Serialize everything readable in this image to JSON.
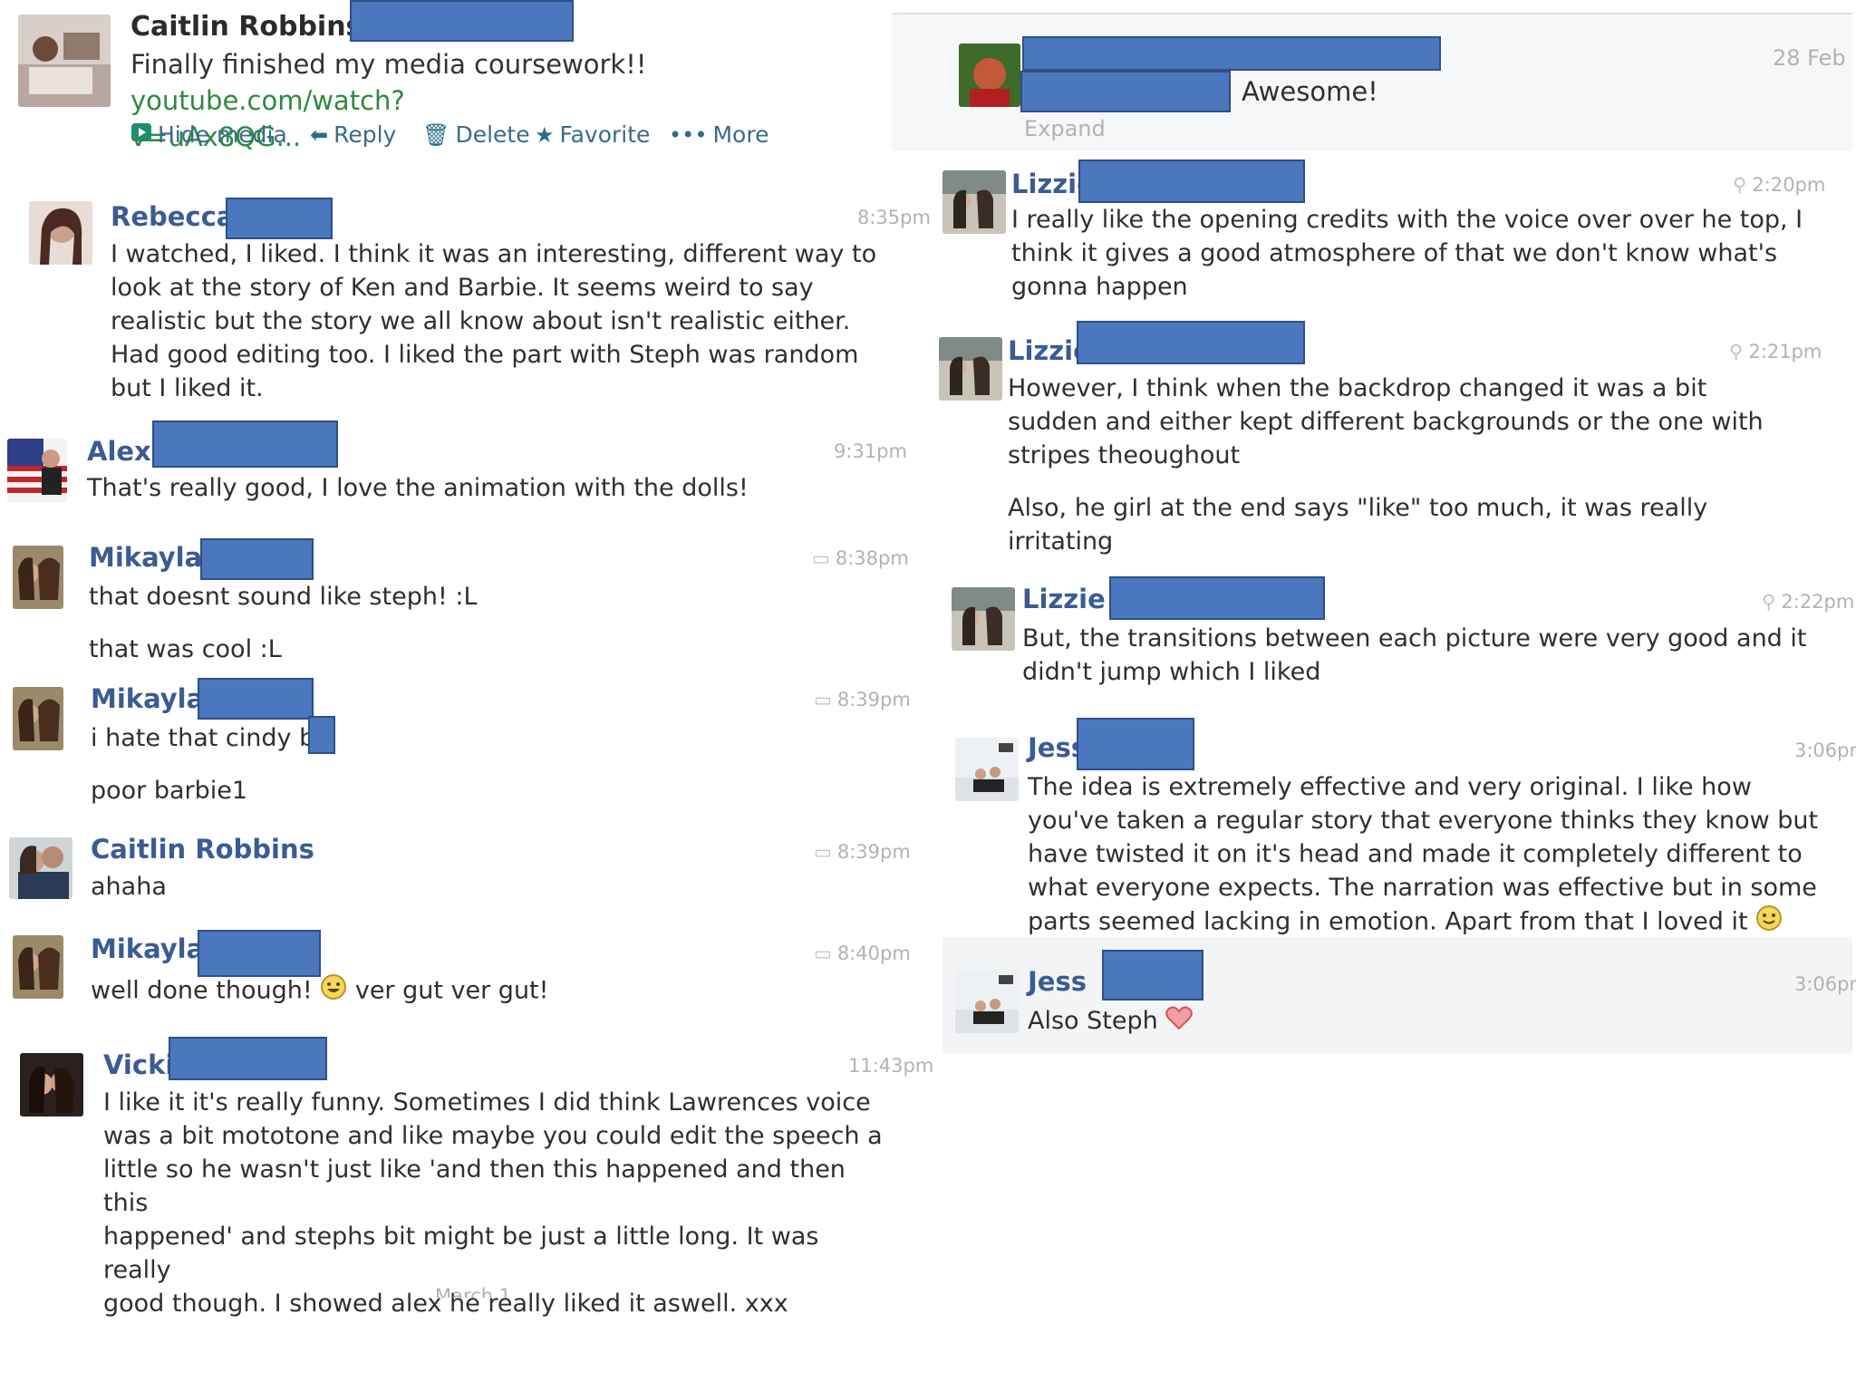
{
  "tweet": {
    "author": "Caitlin Robbins",
    "text": "Finally finished my media coursework!! ",
    "link_line1": "youtube.com/watch?",
    "link_line2": "v=uAx8QG...",
    "actions": [
      {
        "label": "Hide media",
        "icon": "media-icon"
      },
      {
        "label": "Reply",
        "icon": "reply-icon"
      },
      {
        "label": "Delete",
        "icon": "trash-icon"
      },
      {
        "label": "Favorite",
        "icon": "star-icon"
      },
      {
        "label": "More",
        "icon": "more-icon"
      }
    ]
  },
  "left_comments": [
    {
      "name": "Rebecca",
      "time": "8:35pm",
      "text": [
        "I watched, I liked. I think it was an interesting, different way to",
        "look at the story of Ken and Barbie. It seems weird to say",
        "realistic but the story we all know about isn't realistic either.",
        "Had good editing too. I liked the part with Steph was random",
        "but I liked it."
      ]
    },
    {
      "name": "Alex",
      "time": "9:31pm",
      "text": [
        "That's really good, I love the animation with the dolls!"
      ]
    },
    {
      "name": "Mikayla I",
      "time": "8:38pm",
      "text": [
        "that doesnt sound like steph! :L"
      ],
      "extra": "that was cool :L"
    },
    {
      "name": "Mikayla I",
      "time": "8:39pm",
      "text": [
        "i hate that cindy bit"
      ],
      "extra": "poor barbie1"
    },
    {
      "name": "Caitlin Robbins",
      "time": "8:39pm",
      "text": [
        "ahaha"
      ]
    },
    {
      "name": "Mikayla I",
      "time": "8:40pm",
      "text_before": "well done though!",
      "text_after": "ver gut ver gut!"
    },
    {
      "name": "Vicki",
      "time": "11:43pm",
      "text": [
        "I like it it's really funny. Sometimes I did think Lawrences voice",
        "was a bit mototone and like maybe you could edit the speech a",
        "little so he wasn't just like 'and then this happened and then this",
        "happened' and stephs bit might be just a little long. It was really",
        "good though. I showed alex he really liked it aswell. xxx"
      ]
    }
  ],
  "left_footer": "March 1",
  "notification": {
    "date": "28 Feb",
    "message": "Awesome!",
    "expand": "Expand"
  },
  "right_comments": [
    {
      "name": "Lizzie",
      "time": "2:20pm",
      "text": [
        "I really like the opening credits with the voice over over he top, I",
        "think it gives a good atmosphere of that we don't know what's",
        "gonna happen"
      ]
    },
    {
      "name": "Lizzie",
      "time": "2:21pm",
      "text": [
        "However, I think when the backdrop changed it was a bit",
        "sudden and either kept different backgrounds or the one with",
        "stripes theoughout"
      ],
      "extra": [
        "Also, he girl at the end says \"like\" too much, it was really",
        "irritating"
      ]
    },
    {
      "name": "Lizzie",
      "time": "2:22pm",
      "text": [
        "But, the transitions between each picture were very good and it",
        "didn't jump which I liked"
      ]
    },
    {
      "name": "Jess",
      "time": "3:06pm",
      "text": [
        "The idea is extremely effective and very original. I like how",
        "you've taken a regular story that everyone thinks they know but",
        "have twisted it on it's head and made it completely different to",
        "what everyone expects. The narration was effective but in some"
      ],
      "last_line": "parts seemed lacking in emotion. Apart from that I loved it"
    },
    {
      "name": "Jess",
      "time": "3:06pm",
      "text_before": "Also Steph"
    }
  ],
  "colors": {
    "name": "#3b5b94",
    "redaction": "#4b77be",
    "link": "#2c8a3f",
    "timestamp": "#b2b2b2"
  }
}
